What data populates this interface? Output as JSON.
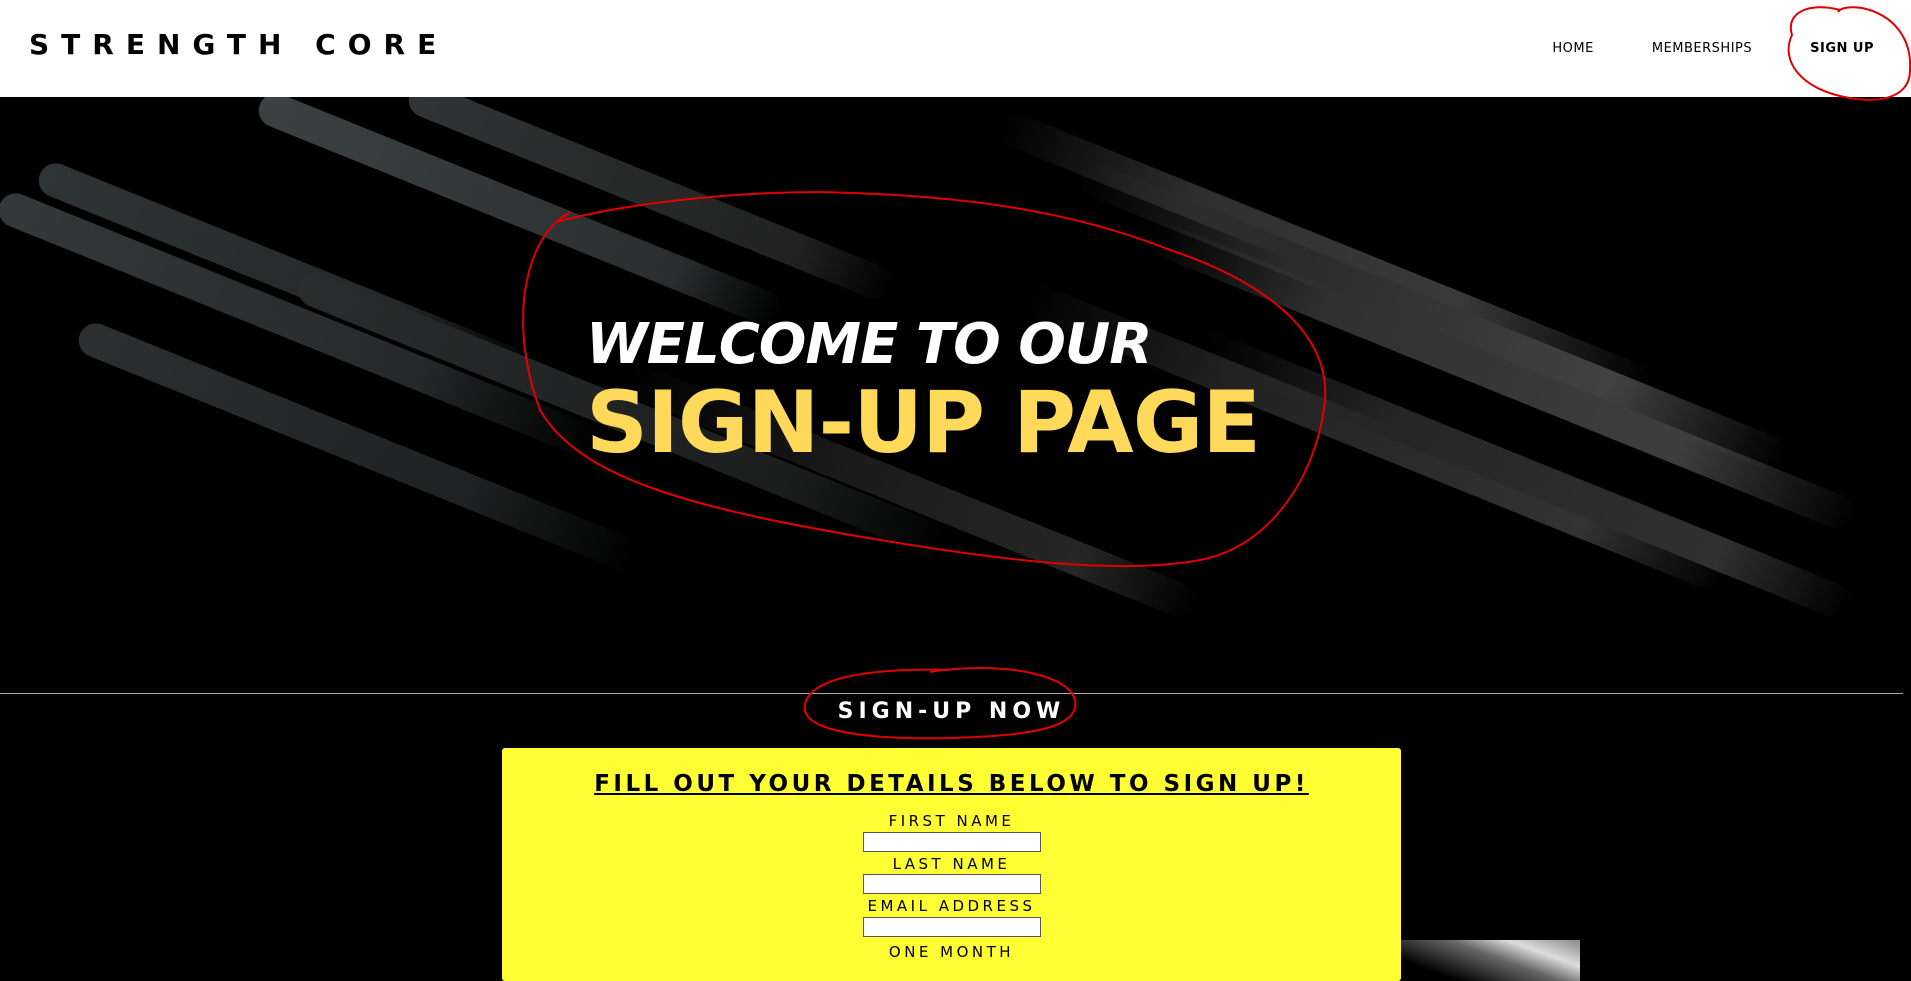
{
  "header": {
    "brand": "STRENGTH CORE",
    "nav": [
      {
        "label": "HOME"
      },
      {
        "label": "MEMBERSHIPS"
      },
      {
        "label": "SIGN UP"
      }
    ]
  },
  "hero": {
    "line1": "WELCOME TO OUR",
    "line2": "SIGN-UP PAGE"
  },
  "signup": {
    "title": "SIGN-UP NOW",
    "form_heading": "FILL OUT YOUR DETAILS BELOW TO SIGN UP!",
    "fields": [
      {
        "label": "FIRST NAME",
        "value": ""
      },
      {
        "label": "LAST NAME",
        "value": ""
      },
      {
        "label": "EMAIL ADDRESS",
        "value": ""
      }
    ],
    "option_label": "ONE MONTH"
  },
  "colors": {
    "accent_yellow": "#ffd95a",
    "form_background": "#ffff33",
    "annotation_red": "#e00000"
  }
}
